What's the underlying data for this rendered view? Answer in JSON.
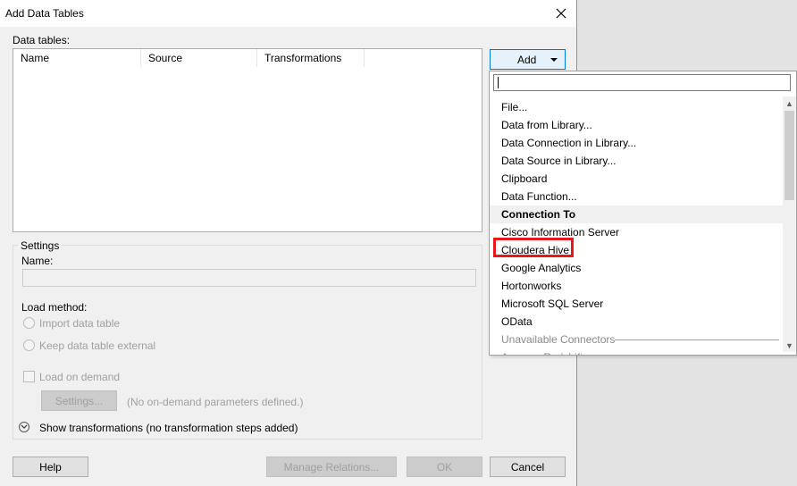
{
  "window": {
    "title": "Add Data Tables"
  },
  "data_tables": {
    "label": "Data tables:",
    "columns": [
      "Name",
      "Source",
      "Transformations"
    ]
  },
  "add_button": {
    "label": "Add"
  },
  "settings": {
    "group_label": "Settings",
    "name_label": "Name:",
    "name_value": "",
    "load_method_label": "Load method:",
    "import_option": "Import data table",
    "keep_external_option": "Keep data table external",
    "load_on_demand": "Load on demand",
    "settings_button": "Settings...",
    "no_params": "(No on-demand parameters defined.)"
  },
  "show_transformations": "Show transformations (no transformation steps added)",
  "footer": {
    "help": "Help",
    "manage_relations": "Manage Relations...",
    "ok": "OK",
    "cancel": "Cancel"
  },
  "dropdown": {
    "search_value": "",
    "items": [
      {
        "label": "File..."
      },
      {
        "label": "Data from Library..."
      },
      {
        "label": "Data Connection in Library..."
      },
      {
        "label": "Data Source in Library..."
      },
      {
        "label": "Clipboard"
      },
      {
        "label": "Data Function..."
      },
      {
        "label": "Connection To"
      },
      {
        "label": "Cisco Information Server"
      },
      {
        "label": "Cloudera Hive"
      },
      {
        "label": "Google Analytics"
      },
      {
        "label": "Hortonworks"
      },
      {
        "label": "Microsoft SQL Server"
      },
      {
        "label": "OData"
      },
      {
        "label": "Unavailable Connectors"
      },
      {
        "label": "Amazon Redshift"
      }
    ]
  },
  "colors": {
    "highlight": "#e8171c",
    "accent": "#0078d7"
  }
}
